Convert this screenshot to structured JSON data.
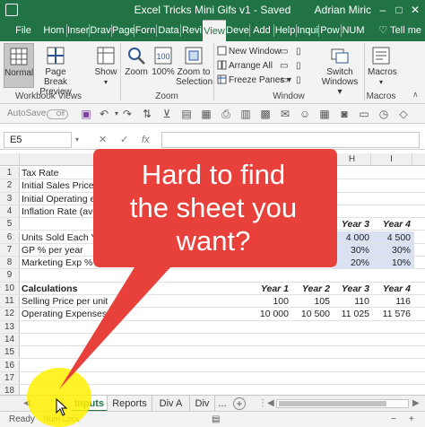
{
  "titlebar": {
    "title": "Excel Tricks Mini Gifs v1  -  Saved",
    "user": "Adrian Miric"
  },
  "ribbon_tabs": [
    "File",
    "Hom",
    "Inser",
    "Drav",
    "Page",
    "Forn",
    "Data",
    "Revi",
    "View",
    "Deve",
    "Add",
    "Help",
    "Inqui",
    "Pow",
    "NUM"
  ],
  "active_tab": "View",
  "tell_me": "Tell me",
  "ribbon": {
    "workbook_views": {
      "label": "Workbook Views",
      "normal": "Normal",
      "page_break": "Page Break Preview"
    },
    "show": "Show",
    "zoom": {
      "label": "Zoom",
      "zoom": "Zoom",
      "hundred": "100%",
      "zoom_to_selection": "Zoom to Selection"
    },
    "window": {
      "label": "Window",
      "new_window": "New Window",
      "arrange_all": "Arrange All",
      "freeze_panes": "Freeze Panes",
      "switch_windows": "Switch Windows"
    },
    "macros": {
      "label": "Macros",
      "macros": "Macros"
    }
  },
  "qat": {
    "autosave": "AutoSave",
    "toggle": "Off"
  },
  "formula_bar": {
    "name_box": "E5",
    "fx": "fx",
    "value": ""
  },
  "columns": [
    "H",
    "I"
  ],
  "rows": [
    {
      "n": "1",
      "a": "Tax Rate"
    },
    {
      "n": "2",
      "a": "Initial Sales Price p"
    },
    {
      "n": "3",
      "a": "Initial Operating ex"
    },
    {
      "n": "4",
      "a": "Inflation Rate (avera"
    },
    {
      "n": "5",
      "a": "",
      "g": "Year 3",
      "h": "Year 4"
    },
    {
      "n": "6",
      "a": "Units Sold Each Ye",
      "g": "4 000",
      "h": "4 500"
    },
    {
      "n": "7",
      "a": "GP % per year",
      "g": "30%",
      "h": "30%"
    },
    {
      "n": "8",
      "a": "Marketing Exp % o",
      "g": "20%",
      "h": "10%"
    },
    {
      "n": "9",
      "a": ""
    },
    {
      "n": "10",
      "a": "Calculations",
      "d": "Year 1",
      "e": "Year 2",
      "g": "Year 3",
      "h": "Year 4"
    },
    {
      "n": "11",
      "a": "Selling Price per unit",
      "d": "100",
      "e": "105",
      "g": "110",
      "h": "116"
    },
    {
      "n": "12",
      "a": "Operating Expenses",
      "d": "10 000",
      "e": "10 500",
      "g": "11 025",
      "h": "11 576"
    },
    {
      "n": "13",
      "a": ""
    },
    {
      "n": "14",
      "a": ""
    },
    {
      "n": "15",
      "a": ""
    },
    {
      "n": "16",
      "a": ""
    },
    {
      "n": "17",
      "a": ""
    },
    {
      "n": "18",
      "a": ""
    }
  ],
  "sheet_tabs": [
    "Inputs",
    "Reports",
    "Div A",
    "Div"
  ],
  "active_sheet": "Inputs",
  "sheet_more": "...",
  "status": {
    "ready": "Ready",
    "num_lock": "Num Lock"
  },
  "callout": {
    "line1": "Hard to find",
    "line2": "the sheet you",
    "line3": "want?"
  },
  "colors": {
    "excel_green": "#217346",
    "callout_red": "#e8403a",
    "highlight_yellow": "#fff000",
    "input_shade": "#d9e1f2"
  }
}
